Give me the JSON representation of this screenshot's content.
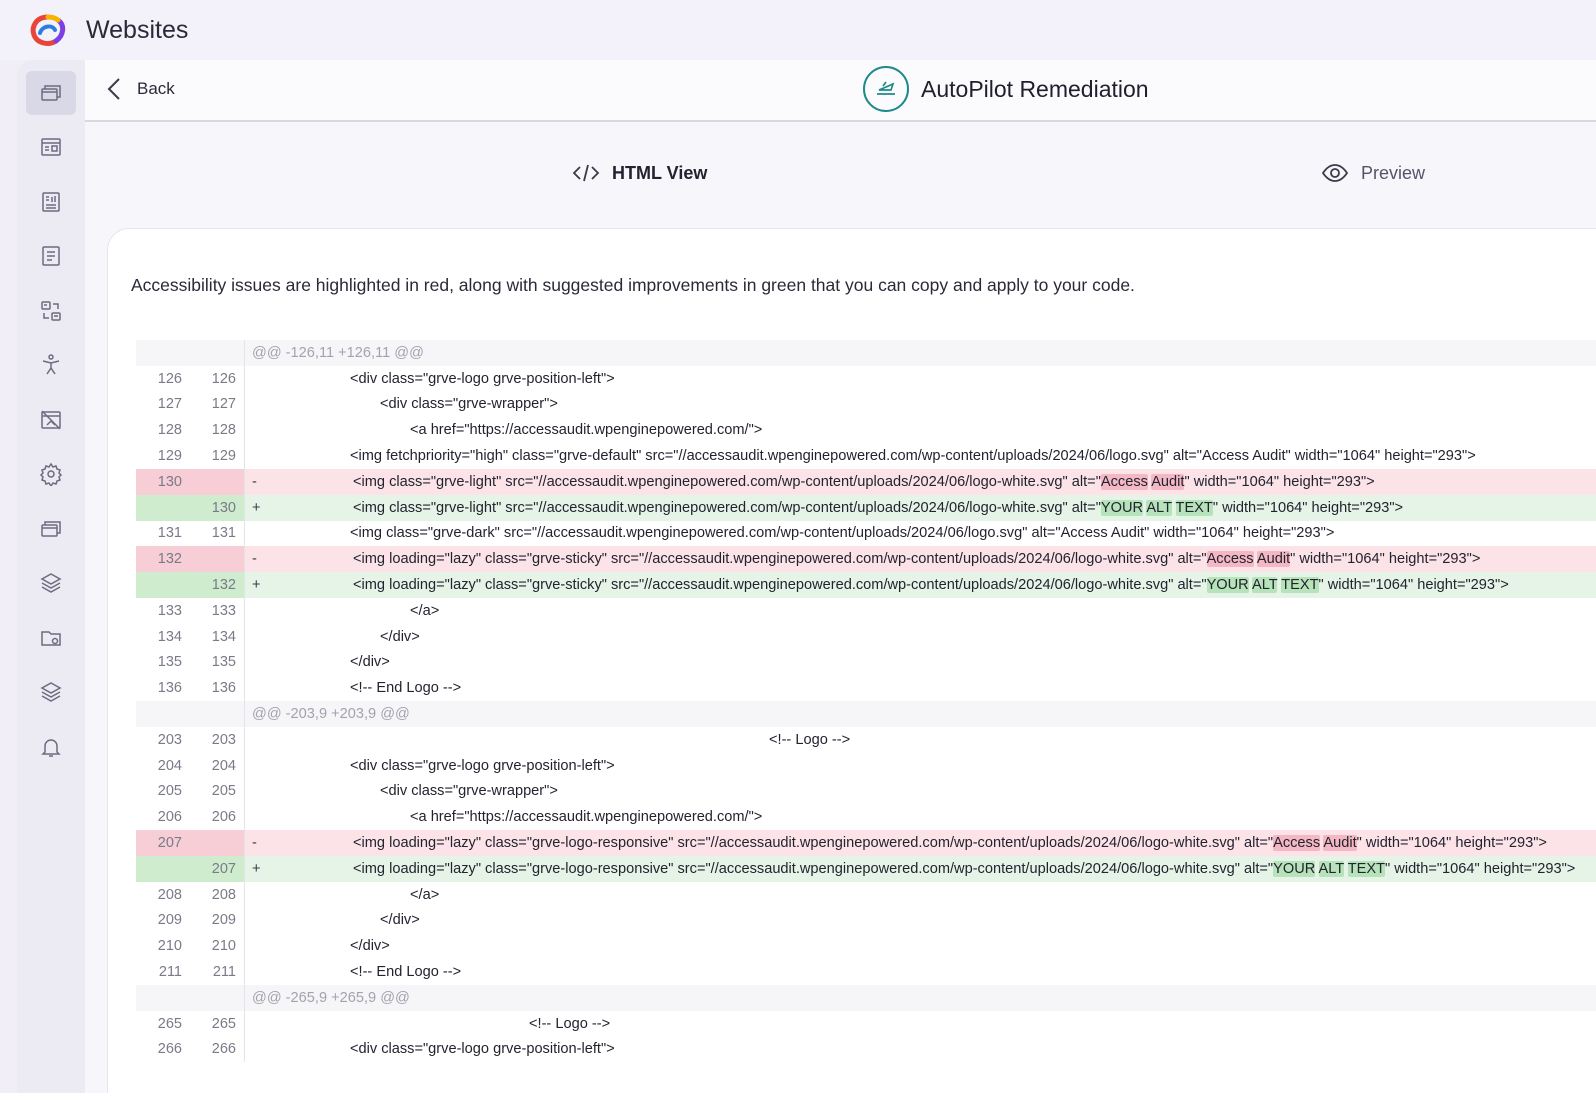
{
  "app": {
    "title": "Websites"
  },
  "header": {
    "back_label": "Back",
    "page_title": "AutoPilot Remediation"
  },
  "tabs": [
    {
      "label": "HTML View",
      "icon": "code-icon",
      "active": true
    },
    {
      "label": "Preview",
      "icon": "eye-icon",
      "active": false
    }
  ],
  "description": "Accessibility issues are highlighted in red, along with suggested improvements in green that you can copy and apply to your code.",
  "sidebar": {
    "items": [
      {
        "icon": "windows-icon",
        "active": true
      },
      {
        "icon": "dashboard-icon"
      },
      {
        "icon": "report-icon"
      },
      {
        "icon": "document-icon"
      },
      {
        "icon": "transfer-icon"
      },
      {
        "icon": "accessibility-icon"
      },
      {
        "icon": "no-image-icon"
      },
      {
        "icon": "settings-icon"
      },
      {
        "icon": "windows-icon"
      },
      {
        "icon": "layers-icon"
      },
      {
        "icon": "folder-settings-icon"
      },
      {
        "icon": "layers-icon"
      },
      {
        "icon": "bell-icon"
      }
    ]
  },
  "diff": [
    {
      "type": "hunk",
      "text": "@@ -126,11 +126,11 @@"
    },
    {
      "type": "ctx",
      "a": "126",
      "b": "126",
      "indent": 2,
      "text": "<div class=\"grve-logo grve-position-left\">"
    },
    {
      "type": "ctx",
      "a": "127",
      "b": "127",
      "indent": 3,
      "text": "<div class=\"grve-wrapper\">"
    },
    {
      "type": "ctx",
      "a": "128",
      "b": "128",
      "indent": 4,
      "text": "<a href=\"https://accessaudit.wpenginepowered.com/\">"
    },
    {
      "type": "ctx",
      "a": "129",
      "b": "129",
      "indent": 2,
      "text": "<img fetchpriority=\"high\" class=\"grve-default\" src=\"//accessaudit.wpenginepowered.com/wp-content/uploads/2024/06/logo.svg\" alt=\"Access Audit\" width=\"1064\" height=\"293\">"
    },
    {
      "type": "del",
      "a": "130",
      "b": "",
      "indent": 2,
      "pre": "<img class=\"grve-light\" src=\"//accessaudit.wpenginepowered.com/wp-content/uploads/2024/06/logo-white.svg\" alt=\"",
      "hl": [
        "Access",
        "Audit"
      ],
      "post": "\" width=\"1064\" height=\"293\">"
    },
    {
      "type": "add",
      "a": "",
      "b": "130",
      "indent": 2,
      "pre": "<img class=\"grve-light\" src=\"//accessaudit.wpenginepowered.com/wp-content/uploads/2024/06/logo-white.svg\" alt=\"",
      "hl": [
        "YOUR",
        "ALT",
        "TEXT"
      ],
      "post": "\" width=\"1064\" height=\"293\">"
    },
    {
      "type": "ctx",
      "a": "131",
      "b": "131",
      "indent": 2,
      "text": "<img class=\"grve-dark\" src=\"//accessaudit.wpenginepowered.com/wp-content/uploads/2024/06/logo.svg\" alt=\"Access Audit\" width=\"1064\" height=\"293\">"
    },
    {
      "type": "del",
      "a": "132",
      "b": "",
      "indent": 2,
      "pre": "<img loading=\"lazy\" class=\"grve-sticky\" src=\"//accessaudit.wpenginepowered.com/wp-content/uploads/2024/06/logo-white.svg\" alt=\"",
      "hl": [
        "Access",
        "Audit"
      ],
      "post": "\" width=\"1064\" height=\"293\">"
    },
    {
      "type": "add",
      "a": "",
      "b": "132",
      "indent": 2,
      "pre": "<img loading=\"lazy\" class=\"grve-sticky\" src=\"//accessaudit.wpenginepowered.com/wp-content/uploads/2024/06/logo-white.svg\" alt=\"",
      "hl": [
        "YOUR",
        "ALT",
        "TEXT"
      ],
      "post": "\" width=\"1064\" height=\"293\">"
    },
    {
      "type": "ctx",
      "a": "133",
      "b": "133",
      "indent": 4,
      "text": "</a>"
    },
    {
      "type": "ctx",
      "a": "134",
      "b": "134",
      "indent": 3,
      "text": "</div>"
    },
    {
      "type": "ctx",
      "a": "135",
      "b": "135",
      "indent": 2,
      "text": "</div>"
    },
    {
      "type": "ctx",
      "a": "136",
      "b": "136",
      "indent": 2,
      "text": "<!-- End Logo -->"
    },
    {
      "type": "hunk",
      "text": "@@ -203,9 +203,9 @@"
    },
    {
      "type": "ctx",
      "a": "203",
      "b": "203",
      "indent": 7,
      "text": "<!-- Logo -->"
    },
    {
      "type": "ctx",
      "a": "204",
      "b": "204",
      "indent": 2,
      "text": "<div class=\"grve-logo grve-position-left\">"
    },
    {
      "type": "ctx",
      "a": "205",
      "b": "205",
      "indent": 3,
      "text": "<div class=\"grve-wrapper\">"
    },
    {
      "type": "ctx",
      "a": "206",
      "b": "206",
      "indent": 4,
      "text": "<a href=\"https://accessaudit.wpenginepowered.com/\">"
    },
    {
      "type": "del",
      "a": "207",
      "b": "",
      "indent": 2,
      "pre": "<img loading=\"lazy\" class=\"grve-logo-responsive\" src=\"//accessaudit.wpenginepowered.com/wp-content/uploads/2024/06/logo-white.svg\" alt=\"",
      "hl": [
        "Access",
        "Audit"
      ],
      "post": "\" width=\"1064\" height=\"293\">"
    },
    {
      "type": "add",
      "a": "",
      "b": "207",
      "indent": 2,
      "pre": "<img loading=\"lazy\" class=\"grve-logo-responsive\" src=\"//accessaudit.wpenginepowered.com/wp-content/uploads/2024/06/logo-white.svg\" alt=\"",
      "hl": [
        "YOUR",
        "ALT",
        "TEXT"
      ],
      "post": "\" width=\"1064\" height=\"293\">"
    },
    {
      "type": "ctx",
      "a": "208",
      "b": "208",
      "indent": 4,
      "text": "</a>"
    },
    {
      "type": "ctx",
      "a": "209",
      "b": "209",
      "indent": 3,
      "text": "</div>"
    },
    {
      "type": "ctx",
      "a": "210",
      "b": "210",
      "indent": 2,
      "text": "</div>"
    },
    {
      "type": "ctx",
      "a": "211",
      "b": "211",
      "indent": 2,
      "text": "<!-- End Logo -->"
    },
    {
      "type": "hunk",
      "text": "@@ -265,9 +265,9 @@"
    },
    {
      "type": "ctx",
      "a": "265",
      "b": "265",
      "indent": 5,
      "text": "<!-- Logo -->"
    },
    {
      "type": "ctx",
      "a": "266",
      "b": "266",
      "indent": 2,
      "text": "<div class=\"grve-logo grve-position-left\">"
    }
  ],
  "colors": {
    "accent": "#3b3c5e",
    "teal": "#1f8a88",
    "deleted_bg": "#fbe3e8",
    "added_bg": "#e5f4e7"
  }
}
